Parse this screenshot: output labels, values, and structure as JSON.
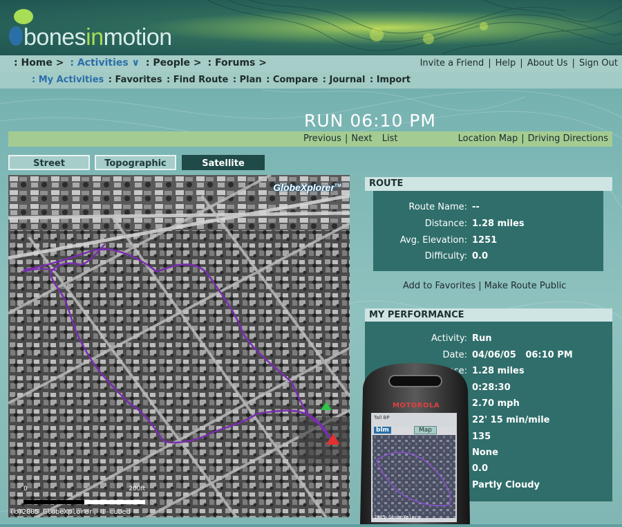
{
  "brand": {
    "name_a": "bones",
    "name_b": "in",
    "name_c": "motion"
  },
  "nav": {
    "items": [
      {
        "label": ": Home >",
        "active": false
      },
      {
        "label": ": Activities ∨",
        "active": true
      },
      {
        "label": ": People >",
        "active": false
      },
      {
        "label": ": Forums >",
        "active": false
      }
    ],
    "utils": [
      "Invite a Friend",
      "Help",
      "About Us",
      "Sign Out"
    ]
  },
  "subnav": {
    "items": [
      {
        "label": ": My Activities",
        "active": true
      },
      {
        "label": ": Favorites",
        "active": false
      },
      {
        "label": ": Find Route",
        "active": false
      },
      {
        "label": ": Plan",
        "active": false
      },
      {
        "label": ": Compare",
        "active": false
      },
      {
        "label": ": Journal",
        "active": false
      },
      {
        "label": ": Import",
        "active": false
      }
    ]
  },
  "page": {
    "title": "RUN 06:10 PM"
  },
  "actions": {
    "previous": "Previous",
    "next": "Next",
    "list": "List",
    "location_map": "Location Map",
    "driving_directions": "Driving Directions"
  },
  "map": {
    "tabs": [
      {
        "label": "Street",
        "active": false
      },
      {
        "label": "Topographic",
        "active": false
      },
      {
        "label": "Satellite",
        "active": true
      }
    ],
    "provider": "GlobeXplorer",
    "provider_mark": "TM",
    "copyright": "(c)2005 GlobeXplorer, i-cubed",
    "scale_start": "0",
    "scale_end": "200ft"
  },
  "route": {
    "heading": "ROUTE",
    "rows": [
      {
        "label": "Route Name:",
        "value": "--"
      },
      {
        "label": "Distance:",
        "value": "1.28 miles"
      },
      {
        "label": "Avg. Elevation:",
        "value": "1251"
      },
      {
        "label": "Difficulty:",
        "value": "0.0"
      }
    ],
    "add_favorites": "Add to Favorites",
    "make_public": "Make Route Public"
  },
  "performance": {
    "heading": "MY PERFORMANCE",
    "rows": [
      {
        "label": "Activity:",
        "value": "Run"
      },
      {
        "label": "Date:",
        "value": "04/06/05   06:10 PM"
      },
      {
        "label": "nce:",
        "value": "1.28 miles"
      },
      {
        "label": "",
        "value": "0:28:30"
      },
      {
        "label": "",
        "value": "2.70 mph"
      },
      {
        "label": "",
        "value": "22' 15 min/mile"
      },
      {
        "label": "",
        "value": "135"
      },
      {
        "label": "",
        "value": "None"
      },
      {
        "label": "",
        "value": "0.0"
      },
      {
        "label": "",
        "value": "Partly Cloudy"
      }
    ]
  },
  "phone": {
    "brand": "MOTOROLA",
    "app": "blm",
    "tab": "Map",
    "status": "Tall  BP",
    "copyright": "2005 GlobeXplore"
  },
  "colors": {
    "accent_blue": "#2a6fa8",
    "route_purple": "#7a2db0",
    "panel_dark": "#2f6e6b",
    "action_bar": "#a4cc92"
  }
}
